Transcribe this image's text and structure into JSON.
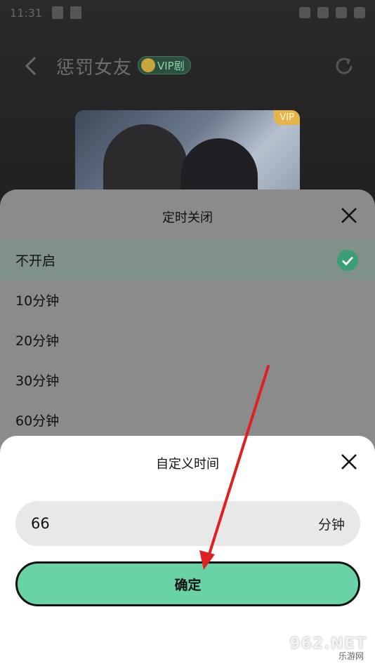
{
  "status_bar": {
    "time": "11:31"
  },
  "header": {
    "title": "惩罚女友",
    "vip_badge": "VIP剧"
  },
  "cover": {
    "vip_tag": "VIP"
  },
  "timer_sheet": {
    "title": "定时关闭",
    "options": [
      {
        "label": "不开启",
        "selected": true
      },
      {
        "label": "10分钟",
        "selected": false
      },
      {
        "label": "20分钟",
        "selected": false
      },
      {
        "label": "30分钟",
        "selected": false
      },
      {
        "label": "60分钟",
        "selected": false
      }
    ]
  },
  "custom_sheet": {
    "title": "自定义时间",
    "input_value": "66",
    "unit": "分钟",
    "confirm_label": "确定"
  },
  "watermark": {
    "top_text": "962.NET",
    "bottom_text": "乐游网"
  },
  "colors": {
    "accent_green": "#69d3a6",
    "check_green": "#3a9f76",
    "arrow_red": "#e02020"
  }
}
